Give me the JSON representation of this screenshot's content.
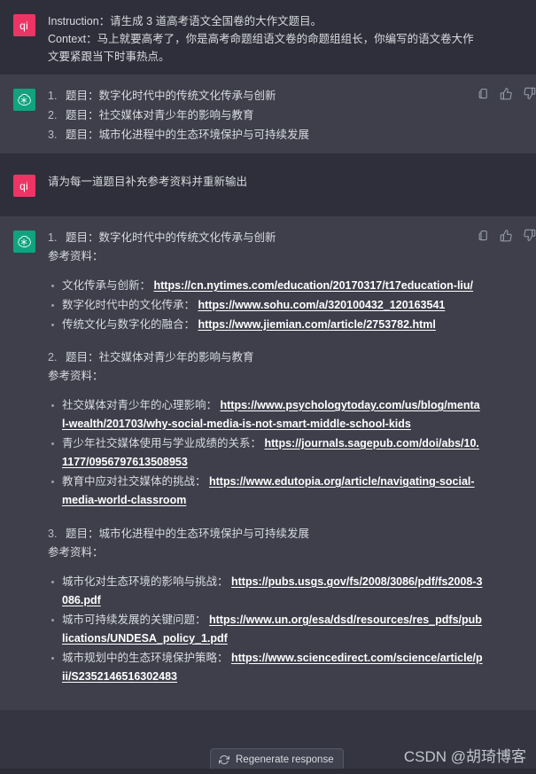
{
  "messages": [
    {
      "role": "user",
      "avatar_label": "qi",
      "lines": [
        "Instruction：请生成 3 道高考语文全国卷的大作文题目。",
        "Context：马上就要高考了，你是高考命题组语文卷的命题组组长，你编写的语文卷大作文要紧跟当下时事热点。"
      ]
    },
    {
      "role": "assistant",
      "items": [
        {
          "idx": "1.",
          "text": "题目：数字化时代中的传统文化传承与创新"
        },
        {
          "idx": "2.",
          "text": "题目：社交媒体对青少年的影响与教育"
        },
        {
          "idx": "3.",
          "text": "题目：城市化进程中的生态环境保护与可持续发展"
        }
      ]
    },
    {
      "role": "user",
      "avatar_label": "qi",
      "lines": [
        "请为每一道题目补充参考资料并重新输出"
      ]
    }
  ],
  "final_answer": {
    "actions": [
      "copy-icon",
      "thumbs-up-icon",
      "thumbs-down-icon"
    ],
    "reference_label": "参考资料：",
    "blocks": [
      {
        "idx": "1.",
        "title": "题目：数字化时代中的传统文化传承与创新",
        "refs_label": "参考资料：",
        "refs": [
          {
            "label": "文化传承与创新：",
            "url": "https://cn.nytimes.com/education/20170317/t17education-liu/"
          },
          {
            "label": "数字化时代中的文化传承：",
            "url": "https://www.sohu.com/a/320100432_120163541"
          },
          {
            "label": "传统文化与数字化的融合：",
            "url": "https://www.jiemian.com/article/2753782.html"
          }
        ]
      },
      {
        "idx": "2.",
        "title": "题目：社交媒体对青少年的影响与教育",
        "refs_label": "参考资料：",
        "refs": [
          {
            "label": "社交媒体对青少年的心理影响：",
            "url": "https://www.psychologytoday.com/us/blog/mental-wealth/201703/why-social-media-is-not-smart-middle-school-kids"
          },
          {
            "label": "青少年社交媒体使用与学业成绩的关系：",
            "url": "https://journals.sagepub.com/doi/abs/10.1177/0956797613508953"
          },
          {
            "label": "教育中应对社交媒体的挑战：",
            "url": "https://www.edutopia.org/article/navigating-social-media-world-classroom"
          }
        ]
      },
      {
        "idx": "3.",
        "title": "题目：城市化进程中的生态环境保护与可持续发展",
        "refs_label": "参考资料：",
        "refs": [
          {
            "label": "城市化对生态环境的影响与挑战：",
            "url": "https://pubs.usgs.gov/fs/2008/3086/pdf/fs2008-3086.pdf"
          },
          {
            "label": "城市可持续发展的关键问题：",
            "url": "https://www.un.org/esa/dsd/resources/res_pdfs/publications/UNDESA_policy_1.pdf"
          },
          {
            "label": "城市规划中的生态环境保护策略：",
            "url": "https://www.sciencedirect.com/science/article/pii/S2352146516302483"
          }
        ]
      }
    ]
  },
  "bottom_bar": {
    "regenerate_label": "Regenerate response",
    "regenerate_icon": "refresh-icon"
  },
  "watermark": "CSDN @胡琦博客",
  "colors": {
    "user_row_bg": "#2e2f3a",
    "assistant_row_bg": "#3e3f4b",
    "page_bg": "#343541",
    "user_avatar": "#ee3465",
    "bot_avatar": "#10a37f",
    "link": "#ffffff",
    "text": "#d9dbe0"
  }
}
